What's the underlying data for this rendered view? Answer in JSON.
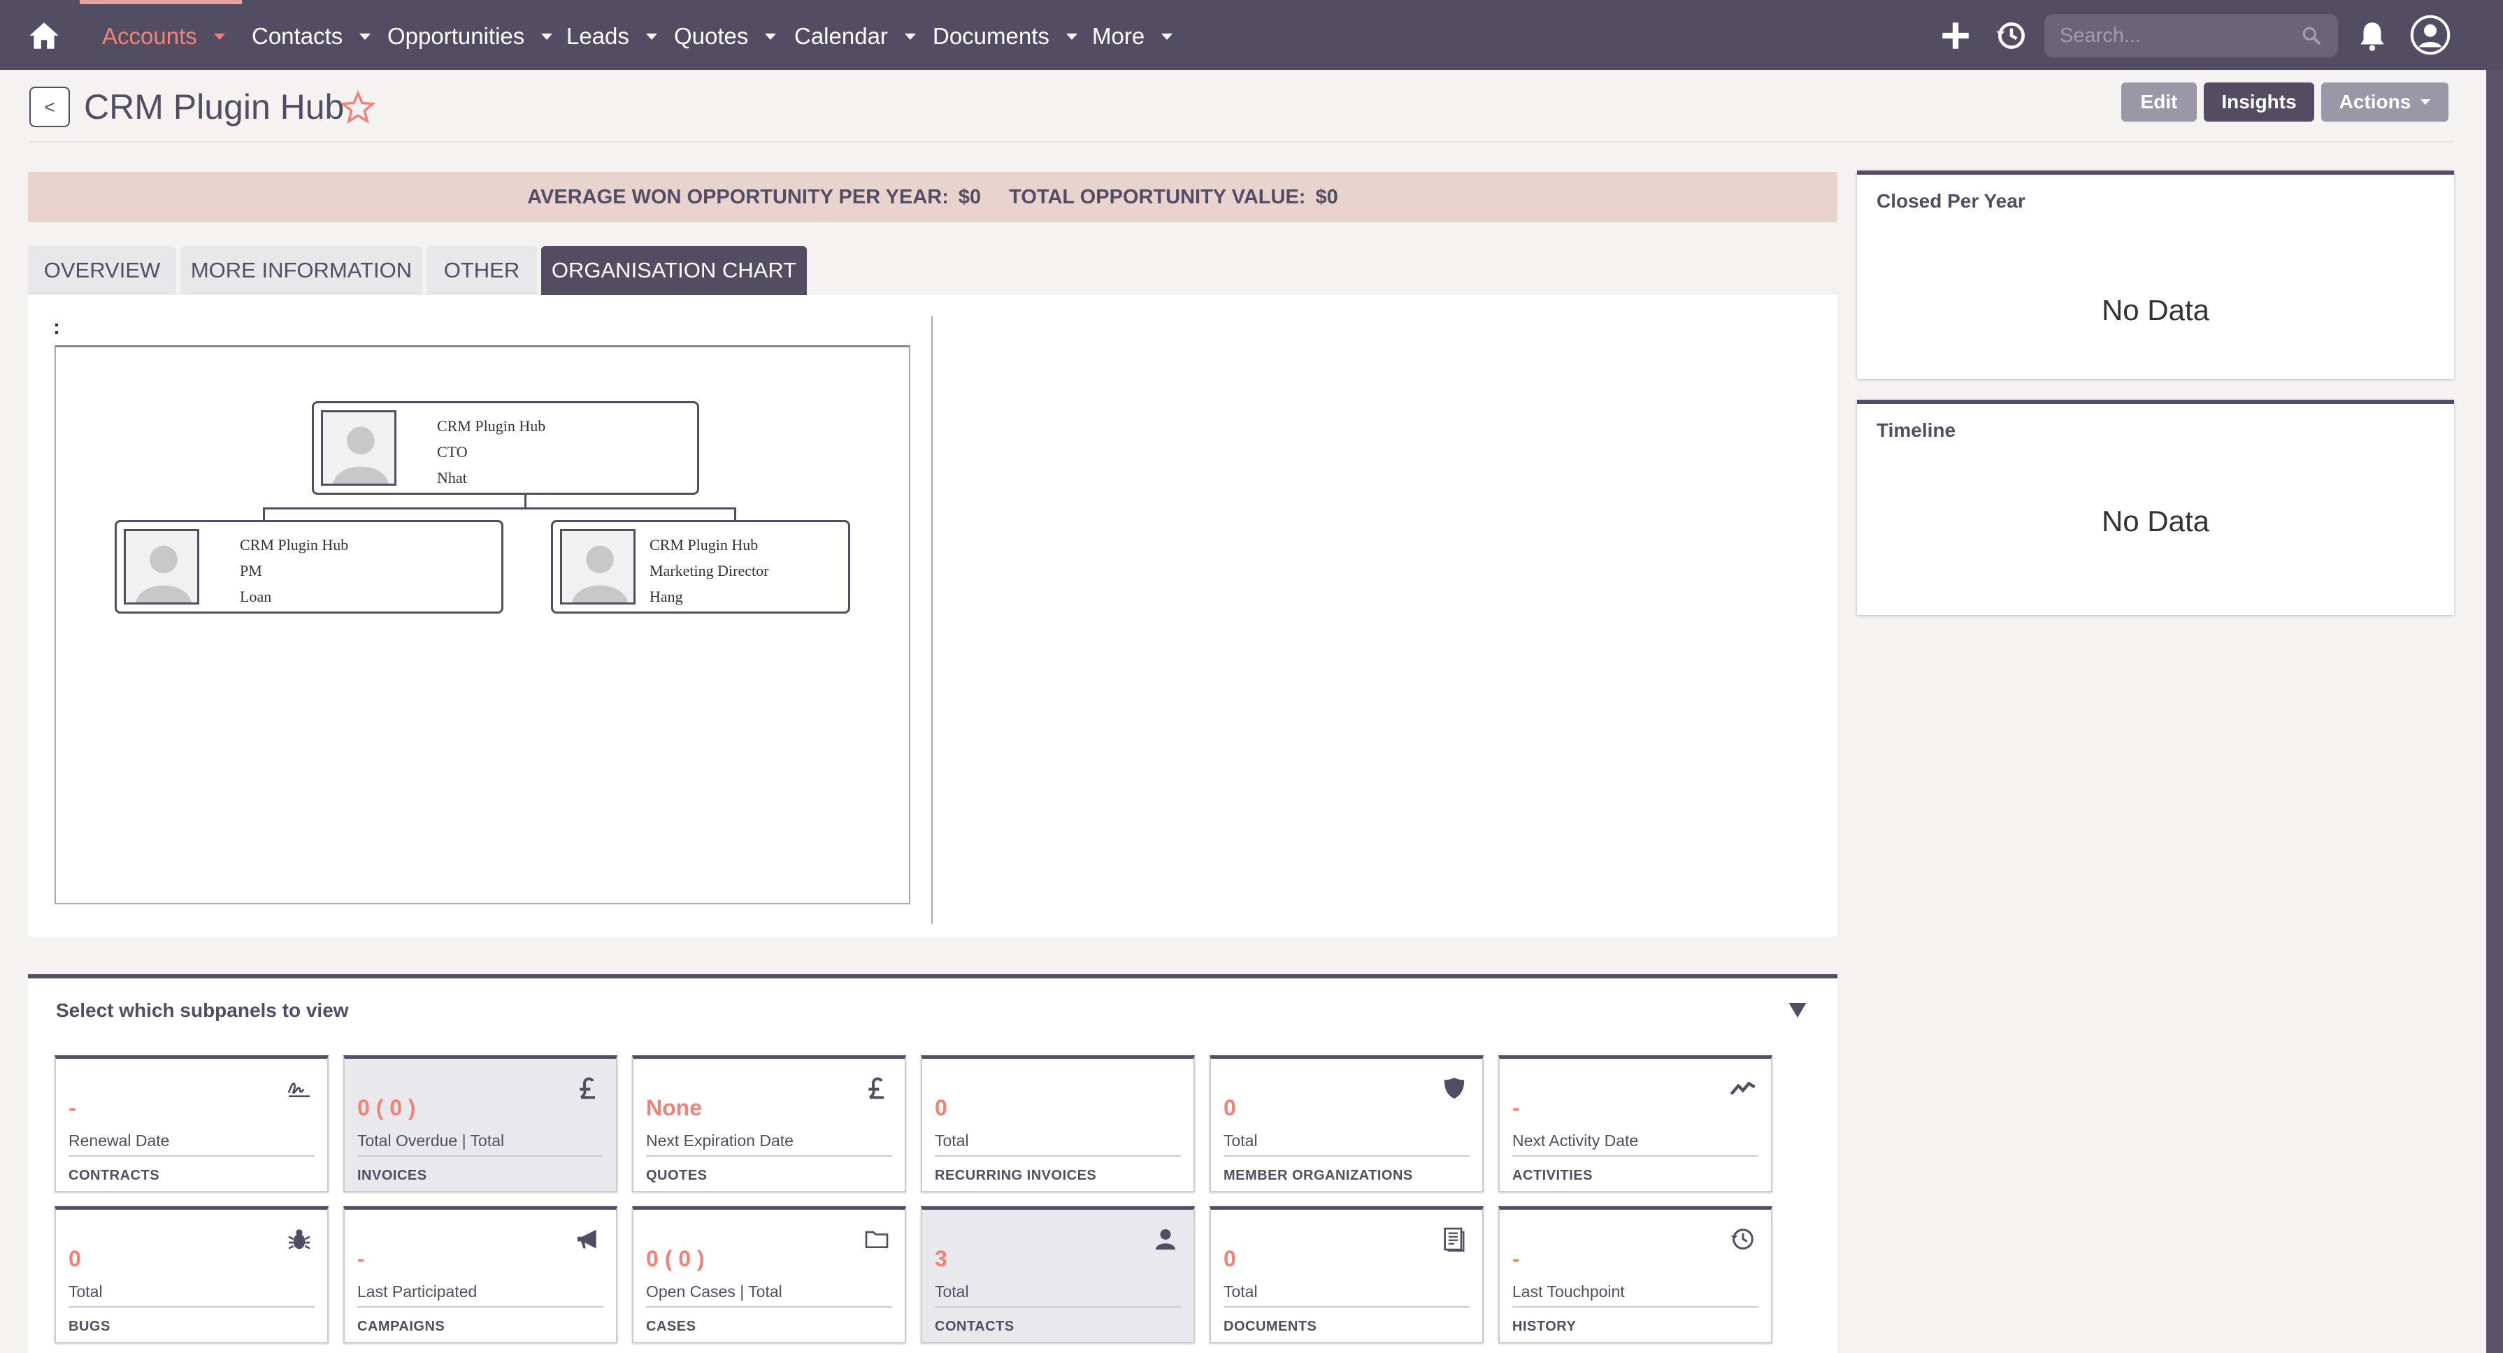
{
  "nav": {
    "items": [
      {
        "label": "Accounts"
      },
      {
        "label": "Contacts"
      },
      {
        "label": "Opportunities"
      },
      {
        "label": "Leads"
      },
      {
        "label": "Quotes"
      },
      {
        "label": "Calendar"
      },
      {
        "label": "Documents"
      },
      {
        "label": "More"
      }
    ],
    "search_placeholder": "Search...",
    "colors": {
      "bar": "#534d64",
      "active": "#f08377",
      "accent": "#e4a29a"
    }
  },
  "header": {
    "back_label": "<",
    "title": "CRM Plugin Hub",
    "buttons": {
      "edit": "Edit",
      "insights": "Insights",
      "actions": "Actions"
    }
  },
  "banner": {
    "avg_label": "AVERAGE WON OPPORTUNITY PER YEAR:",
    "avg_value": "$0",
    "total_label": "TOTAL OPPORTUNITY VALUE:",
    "total_value": "$0"
  },
  "tabs": [
    {
      "label": "OVERVIEW"
    },
    {
      "label": "MORE INFORMATION"
    },
    {
      "label": "OTHER"
    },
    {
      "label": "ORGANISATION CHART"
    }
  ],
  "org_chart": {
    "field_label": ":",
    "root": {
      "company": "CRM Plugin Hub",
      "role": "CTO",
      "name": "Nhat"
    },
    "children": [
      {
        "company": "CRM Plugin Hub",
        "role": "PM",
        "name": "Loan"
      },
      {
        "company": "CRM Plugin Hub",
        "role": "Marketing Director",
        "name": "Hang"
      }
    ]
  },
  "dashlets": [
    {
      "title": "Closed Per Year",
      "body": "No Data"
    },
    {
      "title": "Timeline",
      "body": "No Data"
    }
  ],
  "subpanels": {
    "title": "Select which subpanels to view",
    "tiles": [
      {
        "value": "-",
        "sub": "Renewal Date",
        "name": "CONTRACTS",
        "icon": "signature-icon"
      },
      {
        "value": "0 ( 0 )",
        "sub": "Total Overdue | Total",
        "name": "INVOICES",
        "icon": "pound-icon"
      },
      {
        "value": "None",
        "sub": "Next Expiration Date",
        "name": "QUOTES",
        "icon": "pound-icon"
      },
      {
        "value": "0",
        "sub": "Total",
        "name": "RECURRING INVOICES",
        "icon": ""
      },
      {
        "value": "0",
        "sub": "Total",
        "name": "MEMBER ORGANIZATIONS",
        "icon": "shield-icon"
      },
      {
        "value": "-",
        "sub": "Next Activity Date",
        "name": "ACTIVITIES",
        "icon": "activity-icon"
      },
      {
        "value": "0",
        "sub": "Total",
        "name": "BUGS",
        "icon": "bug-icon"
      },
      {
        "value": "-",
        "sub": "Last Participated",
        "name": "CAMPAIGNS",
        "icon": "megaphone-icon"
      },
      {
        "value": "0 ( 0 )",
        "sub": "Open Cases | Total",
        "name": "CASES",
        "icon": "folder-icon"
      },
      {
        "value": "3",
        "sub": "Total",
        "name": "CONTACTS",
        "icon": "person-icon"
      },
      {
        "value": "0",
        "sub": "Total",
        "name": "DOCUMENTS",
        "icon": "document-icon"
      },
      {
        "value": "-",
        "sub": "Last Touchpoint",
        "name": "HISTORY",
        "icon": "history-icon"
      }
    ]
  }
}
